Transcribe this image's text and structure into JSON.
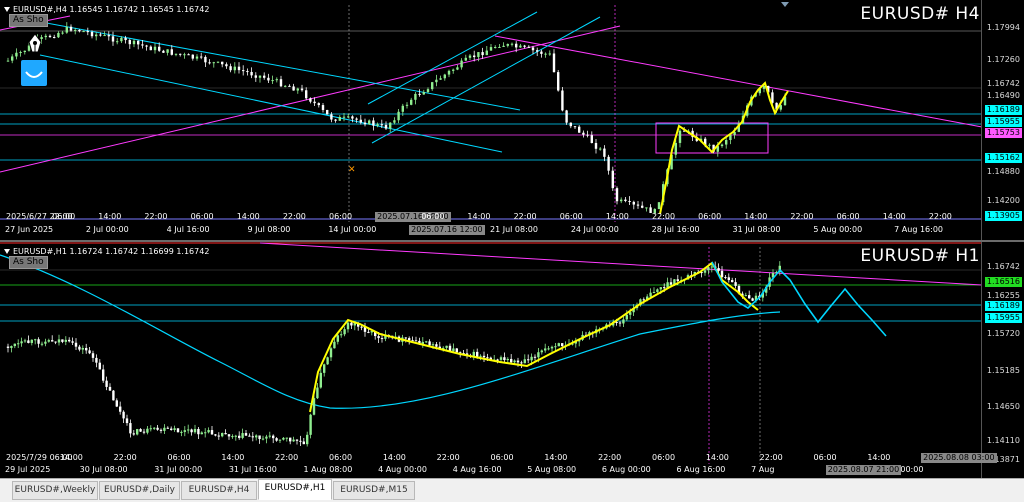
{
  "top_chart": {
    "info": "EURUSD#,H4 1.16545 1.16742 1.16545 1.16742",
    "as_shown_btn": "As Sho",
    "symbol_title": "EURUSD# H4",
    "price_labels": [
      {
        "text": "1.17994",
        "kind": "grey"
      },
      {
        "text": "1.17260",
        "kind": "grey"
      },
      {
        "text": "1.16742",
        "kind": "grey"
      },
      {
        "text": "1.16490",
        "kind": "grey"
      },
      {
        "text": "1.16189",
        "kind": "cyan"
      },
      {
        "text": "1.15955",
        "kind": "cyan"
      },
      {
        "text": "1.15753",
        "kind": "magenta"
      },
      {
        "text": "1.15162",
        "kind": "cyan"
      },
      {
        "text": "1.14880",
        "kind": "grey"
      },
      {
        "text": "1.14200",
        "kind": "grey"
      },
      {
        "text": "1.13905",
        "kind": "cyan"
      }
    ],
    "time_labels": [
      "2025/6/27 22:00",
      "06:00",
      "14:00",
      "22:00",
      "06:00",
      "14:00",
      "22:00",
      "06:00",
      "2025.07.16 18:00",
      "06:00",
      "14:00",
      "22:00",
      "06:00",
      "14:00",
      "22:00",
      "06:00",
      "14:00",
      "22:00",
      "06:00",
      "14:00",
      "22:00"
    ],
    "date_labels": [
      "27 Jun 2025",
      "2 Jul 00:00",
      "4 Jul 16:00",
      "9 Jul 08:00",
      "14 Jul 00:00",
      "2025.07.16 12:00",
      "21 Jul 08:00",
      "24 Jul 00:00",
      "28 Jul 16:00",
      "31 Jul 08:00",
      "5 Aug 00:00",
      "7 Aug 16:00"
    ]
  },
  "bottom_chart": {
    "info": "EURUSD#,H1 1.16724 1.16742 1.16699 1.16742",
    "as_shown_btn": "As Sho",
    "symbol_title": "EURUSD# H1",
    "price_labels": [
      {
        "text": "1.16742",
        "kind": "grey"
      },
      {
        "text": "1.16516",
        "kind": "green"
      },
      {
        "text": "1.16255",
        "kind": "grey"
      },
      {
        "text": "1.16189",
        "kind": "cyan"
      },
      {
        "text": "1.15955",
        "kind": "cyan"
      },
      {
        "text": "1.15720",
        "kind": "grey"
      },
      {
        "text": "1.15185",
        "kind": "grey"
      },
      {
        "text": "1.14650",
        "kind": "grey"
      },
      {
        "text": "1.14110",
        "kind": "grey"
      },
      {
        "text": "1.13871",
        "kind": "grey"
      }
    ],
    "time_labels": [
      "2025/7/29 06:00",
      "14:00",
      "22:00",
      "06:00",
      "14:00",
      "22:00",
      "06:00",
      "14:00",
      "22:00",
      "06:00",
      "14:00",
      "22:00",
      "06:00",
      "14:00",
      "22:00",
      "06:00",
      "14:00",
      "2025.08.08 03:00"
    ],
    "date_labels": [
      "29 Jul 2025",
      "30 Jul 08:00",
      "31 Jul 00:00",
      "31 Jul 16:00",
      "1 Aug 08:00",
      "4 Aug 00:00",
      "4 Aug 16:00",
      "5 Aug 08:00",
      "6 Aug 00:00",
      "6 Aug 16:00",
      "7 Aug",
      "2025.08.07 21:00",
      "00:00"
    ]
  },
  "tabs": [
    {
      "label": "EURUSD#,Weekly",
      "active": false
    },
    {
      "label": "EURUSD#,Daily",
      "active": false
    },
    {
      "label": "EURUSD#,H4",
      "active": false
    },
    {
      "label": "EURUSD#,H1",
      "active": true
    },
    {
      "label": "EURUSD#,M15",
      "active": false
    }
  ],
  "colors": {
    "background": "#000000",
    "bull_candle": "#90ee90",
    "bear_candle": "#ffffff",
    "trend_cyan": "#00d7ff",
    "trend_magenta": "#ff3bff",
    "hand_yellow": "#ffff00",
    "label_cyan": "#00ffff",
    "label_magenta": "#ff59ff",
    "label_green": "#22dd22",
    "label_grey": "#c8c8c8"
  }
}
